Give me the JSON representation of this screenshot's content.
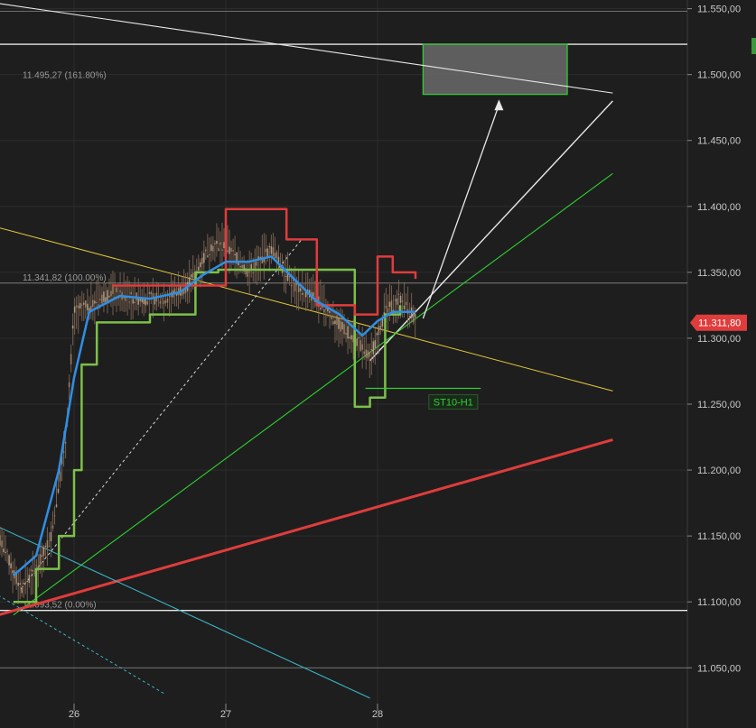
{
  "chart_data": {
    "type": "candlestick",
    "instrument_price_label": "11.311,80",
    "colors": {
      "background": "#1e1e1e",
      "grid": "#2c2c2c",
      "price_badge": "#e03c3c",
      "supertrend_down": "#e03c3c",
      "supertrend_up": "#7cc04a",
      "moving_average": "#2f8fe6",
      "target_box": "#37c837",
      "trend_yellow": "#e3c63a",
      "trend_green": "#2ed12e",
      "trend_red": "#e03c3c",
      "trend_cyan": "#39b6c8"
    },
    "y_axis": {
      "min": 11030,
      "max": 11560,
      "ticks": [
        "11.050,00",
        "11.100,00",
        "11.150,00",
        "11.200,00",
        "11.250,00",
        "11.300,00",
        "11.350,00",
        "11.400,00",
        "11.450,00",
        "11.500,00",
        "11.550,00"
      ]
    },
    "x_axis": {
      "ticks": [
        {
          "label": "26",
          "day": 26.0
        },
        {
          "label": "27",
          "day": 27.0
        },
        {
          "label": "28",
          "day": 28.0
        }
      ]
    },
    "fib_levels": [
      {
        "label": "11.495,27 (161.80%)",
        "value": 11495.27
      },
      {
        "label": "11.341,82 (100.00%)",
        "value": 11341.82
      },
      {
        "label": "11.093,52 (0.00%)",
        "value": 11093.52
      }
    ],
    "horizontal_lines": [
      11548,
      11523,
      11341.82,
      11093.52,
      11050
    ],
    "target_zone": {
      "day_start": 28.3,
      "day_end": 29.25,
      "low": 11485,
      "high": 11523
    },
    "trend_lines": [
      {
        "name": "white-upper",
        "points": [
          [
            25.5,
            11554
          ],
          [
            29.55,
            11486
          ]
        ]
      },
      {
        "name": "white-fan",
        "points": [
          [
            27.95,
            11283
          ],
          [
            29.55,
            11480
          ]
        ]
      },
      {
        "name": "yellow",
        "points": [
          [
            25.5,
            11384
          ],
          [
            29.55,
            11260
          ]
        ]
      },
      {
        "name": "green",
        "points": [
          [
            25.6,
            11090
          ],
          [
            29.55,
            11425
          ]
        ]
      },
      {
        "name": "red",
        "points": [
          [
            25.5,
            11090
          ],
          [
            29.55,
            11223
          ]
        ]
      },
      {
        "name": "cyan",
        "points": [
          [
            25.5,
            11157
          ],
          [
            27.95,
            11027
          ]
        ]
      },
      {
        "name": "arrow",
        "points": [
          [
            28.3,
            11315
          ],
          [
            28.8,
            11477
          ]
        ]
      }
    ],
    "annotation": {
      "label": "ST10-H1",
      "day": 28.35,
      "value": 11251
    },
    "price_path": [
      [
        25.5,
        11150
      ],
      [
        25.65,
        11110
      ],
      [
        25.75,
        11125
      ],
      [
        25.85,
        11150
      ],
      [
        25.95,
        11230
      ],
      [
        26.0,
        11320
      ],
      [
        26.1,
        11325
      ],
      [
        26.25,
        11335
      ],
      [
        26.4,
        11330
      ],
      [
        26.6,
        11330
      ],
      [
        26.75,
        11340
      ],
      [
        26.9,
        11370
      ],
      [
        27.0,
        11370
      ],
      [
        27.15,
        11350
      ],
      [
        27.3,
        11368
      ],
      [
        27.45,
        11340
      ],
      [
        27.6,
        11330
      ],
      [
        27.75,
        11310
      ],
      [
        27.85,
        11300
      ],
      [
        27.95,
        11285
      ],
      [
        28.05,
        11320
      ],
      [
        28.15,
        11330
      ],
      [
        28.25,
        11315
      ]
    ],
    "moving_average": [
      [
        25.6,
        11120
      ],
      [
        25.75,
        11135
      ],
      [
        25.9,
        11200
      ],
      [
        26.0,
        11270
      ],
      [
        26.1,
        11320
      ],
      [
        26.3,
        11332
      ],
      [
        26.5,
        11330
      ],
      [
        26.7,
        11335
      ],
      [
        26.85,
        11348
      ],
      [
        27.0,
        11358
      ],
      [
        27.15,
        11358
      ],
      [
        27.3,
        11362
      ],
      [
        27.45,
        11345
      ],
      [
        27.6,
        11328
      ],
      [
        27.75,
        11318
      ],
      [
        27.9,
        11302
      ],
      [
        28.0,
        11313
      ],
      [
        28.1,
        11320
      ],
      [
        28.25,
        11320
      ]
    ],
    "supertrend_up": [
      [
        25.6,
        11100
      ],
      [
        25.75,
        11125
      ],
      [
        25.9,
        11150
      ],
      [
        26.0,
        11200
      ],
      [
        26.05,
        11280
      ],
      [
        26.15,
        11312
      ],
      [
        26.5,
        11318
      ],
      [
        26.75,
        11318
      ],
      [
        26.8,
        11350
      ],
      [
        26.95,
        11352
      ],
      [
        27.85,
        11248
      ],
      [
        27.95,
        11255
      ],
      [
        28.05,
        11318
      ],
      [
        28.15,
        11325
      ]
    ],
    "supertrend_down": [
      [
        26.25,
        11340
      ],
      [
        26.6,
        11340
      ],
      [
        27.0,
        11398
      ],
      [
        27.25,
        11398
      ],
      [
        27.4,
        11375
      ],
      [
        27.6,
        11325
      ],
      [
        27.85,
        11318
      ],
      [
        28.0,
        11362
      ],
      [
        28.1,
        11350
      ],
      [
        28.25,
        11345
      ]
    ]
  }
}
